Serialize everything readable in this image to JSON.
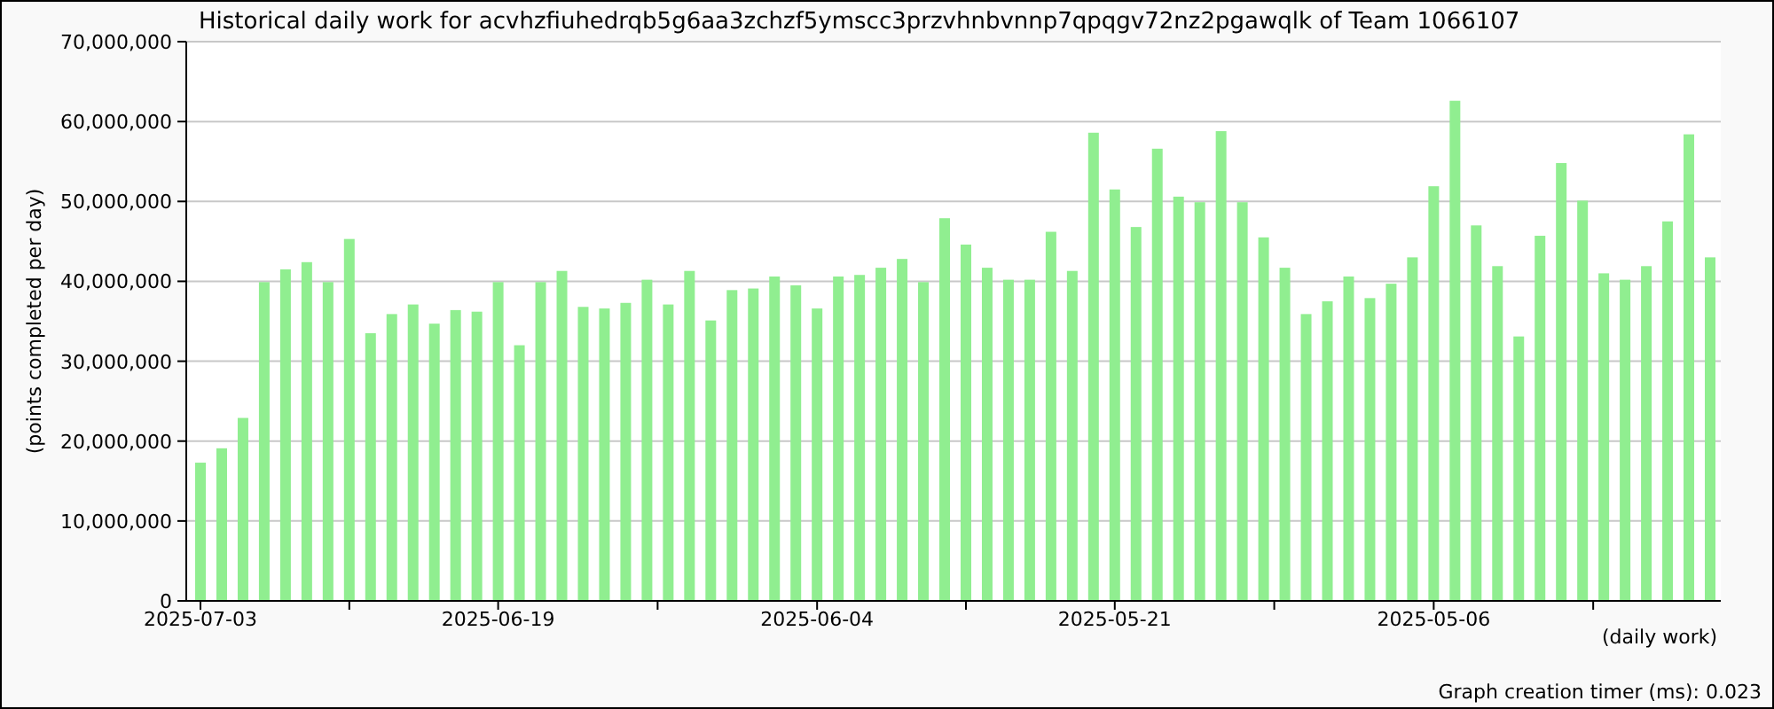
{
  "chart": {
    "chart_data": {
      "type": "bar",
      "title": "Historical daily work for acvhzfiuhedrqb5g6aa3zchzf5ymscc3przvhnbvnnp7qpqgv72nz2pgawqlk of Team 1066107",
      "xlabel": "(daily work)",
      "ylabel": "(points completed per day)",
      "categories": [
        "2025-07-03",
        null,
        null,
        null,
        null,
        null,
        null,
        null,
        null,
        null,
        null,
        null,
        null,
        null,
        "2025-06-19",
        null,
        null,
        null,
        null,
        null,
        null,
        null,
        null,
        null,
        null,
        null,
        null,
        null,
        null,
        "2025-06-04",
        null,
        null,
        null,
        null,
        null,
        null,
        null,
        null,
        null,
        null,
        null,
        null,
        null,
        "2025-05-21",
        null,
        null,
        null,
        null,
        null,
        null,
        null,
        null,
        null,
        null,
        null,
        null,
        null,
        null,
        "2025-05-06",
        null,
        null,
        null,
        null,
        null,
        null,
        null,
        null,
        null,
        null,
        null,
        null,
        null
      ],
      "series": [
        {
          "color": "#90ee90",
          "values": [
            17300000,
            19100000,
            22900000,
            39900000,
            41500000,
            42400000,
            39900000,
            45300000,
            33500000,
            35900000,
            37100000,
            34700000,
            36400000,
            36200000,
            39900000,
            32000000,
            39900000,
            41300000,
            36800000,
            36600000,
            37300000,
            40200000,
            37100000,
            41300000,
            35100000,
            38900000,
            39100000,
            40600000,
            39500000,
            36600000,
            40600000,
            40800000,
            41700000,
            42800000,
            39900000,
            47900000,
            44600000,
            41700000,
            40200000,
            40200000,
            46200000,
            41300000,
            58600000,
            51500000,
            46800000,
            56600000,
            50600000,
            49900000,
            58800000,
            49900000,
            45500000,
            41700000,
            35900000,
            37500000,
            40600000,
            37900000,
            39700000,
            43000000,
            51900000,
            62600000,
            47000000,
            41900000,
            33100000,
            45700000,
            54800000,
            50100000,
            41000000,
            40200000,
            41900000,
            47500000,
            58400000,
            43000000
          ]
        }
      ],
      "ylim": [
        0,
        70000000
      ],
      "grid": true,
      "yticks": [
        {
          "value": 0,
          "label": "0"
        },
        {
          "value": 10000000,
          "label": "10,000,000"
        },
        {
          "value": 20000000,
          "label": "20,000,000"
        },
        {
          "value": 30000000,
          "label": "30,000,000"
        },
        {
          "value": 40000000,
          "label": "40,000,000"
        },
        {
          "value": 50000000,
          "label": "50,000,000"
        },
        {
          "value": 60000000,
          "label": "60,000,000"
        },
        {
          "value": 70000000,
          "label": "70,000,000"
        }
      ]
    }
  },
  "footer": {
    "timer": "Graph creation timer (ms): 0.023"
  }
}
